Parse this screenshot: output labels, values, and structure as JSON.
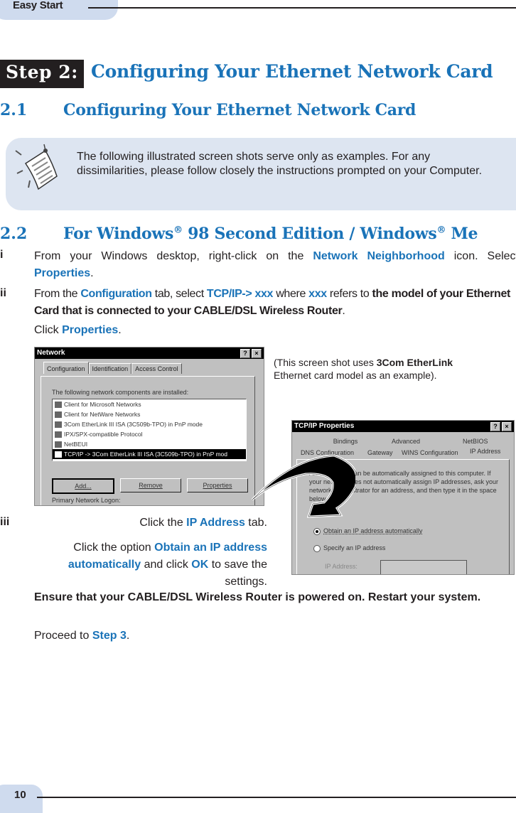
{
  "header": {
    "section_label": "Easy Start"
  },
  "step": {
    "label": "Step 2:",
    "title": "Configuring Your Ethernet Network Card"
  },
  "section_2_1": {
    "number": "2.1",
    "title": "Configuring Your Ethernet Network Card"
  },
  "note": {
    "icon": "note-paper-icon",
    "text": "The following illustrated screen shots serve only as examples.  For any dissimilarities, please follow closely the instructions prompted on your Computer."
  },
  "section_2_2": {
    "number": "2.2",
    "title_part1": "For Windows",
    "reg1": "®",
    "title_part2": " 98 Second Edition / Windows",
    "reg2": "®",
    "title_part3": " Me"
  },
  "steps": {
    "i": {
      "marker": "i",
      "t1": "From your Windows desktop, right-click on the ",
      "h1": "Network Neighborhood",
      "t2": " icon.  Select ",
      "h2": "Properties",
      "t3": "."
    },
    "ii": {
      "marker": "ii",
      "t1": "From the ",
      "h1": "Configuration",
      "t2": " tab, select ",
      "h2": "TCP/IP-> xxx",
      "t3": " where ",
      "h3": "xxx",
      "t4": " refers to ",
      "b1": "the model of your Ethernet Card that is connected to your CABLE/DSL Wireless Router",
      "t5": ".",
      "click_t": "Click ",
      "click_h": "Properties",
      "click_end": "."
    },
    "iii": {
      "marker": "iii",
      "t1": "Click the ",
      "h1": "IP Address",
      "t2": " tab.",
      "p2_t1": "Click the option ",
      "p2_h1": "Obtain an IP address automatically",
      "p2_t2": " and click ",
      "p2_h2": "OK",
      "p2_t3": " to save the settings."
    }
  },
  "caption": {
    "t1": "(This screen shot uses ",
    "b1": "3Com EtherLink",
    "t2": " Ethernet card model as an example)."
  },
  "network_dialog": {
    "title": "Network",
    "help_btn": "?",
    "close_btn": "×",
    "tabs": [
      "Configuration",
      "Identification",
      "Access Control"
    ],
    "components_label": "The following network components are installed:",
    "components": [
      "Client for Microsoft Networks",
      "Client for NetWare Networks",
      "3Com EtherLink III ISA (3C509b-TPO) in PnP mode",
      "IPX/SPX-compatible Protocol",
      "NetBEUI",
      "TCP/IP -> 3Com EtherLink III ISA (3C509b-TPO) in PnP mod"
    ],
    "selected_index": 5,
    "buttons": [
      "Add...",
      "Remove",
      "Properties"
    ],
    "logon_label": "Primary Network Logon:"
  },
  "tcpip_dialog": {
    "title": "TCP/IP Properties",
    "help_btn": "?",
    "close_btn": "×",
    "tabs_row1": [
      "Bindings",
      "Advanced",
      "NetBIOS"
    ],
    "tabs_row2": [
      "DNS Configuration",
      "Gateway",
      "WINS Configuration",
      "IP Address"
    ],
    "description": "An IP address can be automatically assigned to this computer. If your network does not automatically assign IP addresses, ask your network administrator for an address, and then type it in the space below.",
    "option_auto": "Obtain an IP address automatically",
    "option_specify": "Specify an IP address",
    "ip_label": "IP Address:",
    "selected_option": "auto"
  },
  "closing": {
    "b1": "Ensure that your CABLE/DSL Wireless Router is powered on.  Restart your system.",
    "t1": "Proceed to ",
    "h1": "Step 3",
    "t2": "."
  },
  "footer": {
    "page_number": "10"
  }
}
